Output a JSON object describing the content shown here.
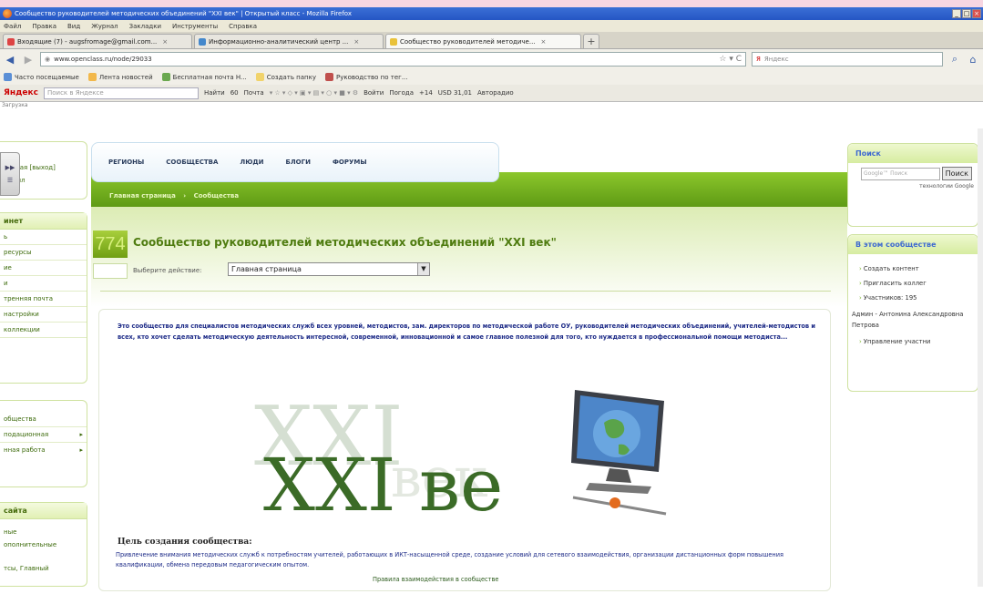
{
  "browser": {
    "window_title": "Сообщество руководителей методических объединений \"XXI век\" | Открытый класс - Mozilla Firefox",
    "menu": [
      "Файл",
      "Правка",
      "Вид",
      "Журнал",
      "Закладки",
      "Инструменты",
      "Справка"
    ],
    "tabs": [
      {
        "label": "Входящие (7) - augsfromage@gmail.com..."
      },
      {
        "label": "Информационно-аналитический центр ..."
      },
      {
        "label": "Сообщество руководителей методиче..."
      }
    ],
    "url": "www.openclass.ru/node/29033",
    "search_placeholder": "Яндекс",
    "bookmarks": [
      "Часто посещаемые",
      "Лента новостей",
      "Бесплатная почта H...",
      "Создать папку",
      "Руководство по тег..."
    ],
    "yandex_label": "Яндекс",
    "yandex_search_placeholder": "Поиск в Яндексе",
    "yandex_items": [
      "Найти",
      "60",
      "Почта",
      "Войти",
      "Погода",
      "+14",
      "USD 31,01",
      "Авторадио"
    ],
    "status_text": "Загрузка"
  },
  "left": {
    "box1_items": [
      "ход",
      "личная [выход]",
      "офайл"
    ],
    "box2_header": "инет",
    "box2_items": [
      "ь",
      "ресурсы",
      "ие",
      "и",
      "тренняя почта",
      "настройки",
      "коллекции"
    ],
    "box3_items": [
      "общества",
      "подационная",
      "нная работа"
    ],
    "box4_header": "сайта",
    "box4_items": [
      "ные",
      "ополнительные",
      "тсы, Главный"
    ]
  },
  "nav": {
    "items": [
      "РЕГИОНЫ",
      "СООБЩЕСТВА",
      "ЛЮДИ",
      "БЛОГИ",
      "ФОРУМЫ"
    ],
    "breadcrumbs": [
      "Главная страница",
      "Сообщества"
    ]
  },
  "main": {
    "badge": "774",
    "title": "Сообщество руководителей методических объединений \"XXI век\"",
    "action_label": "Выберите действие:",
    "action_value": "Главная страница",
    "intro": "Это сообщество для специалистов методических служб всех уровней, методистов, зам. директоров по методической работе ОУ, руководителей методических объединений, учителей-методистов и всех, кто хочет сделать методическую деятельность интересной, современной, инновационной и самое главное полезной для того, кто нуждается в профессиональной помощи методиста...",
    "logo_text": "XXI век",
    "goal_heading": "Цель создания сообщества:",
    "goal_text": "Привлечение внимания методических служб к потребностям учителей, работающих в ИКТ-насыщенной среде, создание условий для сетевого взаимодействия, организации дистанционных форм повышения квалификации, обмена передовым педагогическим опытом.",
    "rules_link": "Правила взаимодействия в сообществе"
  },
  "right": {
    "search_header": "Поиск",
    "search_placeholder": "Google™ Поиск",
    "search_button": "Поиск",
    "powered": "технологии Google",
    "community_header": "В этом сообществе",
    "items": [
      "Создать контент",
      "Пригласить коллег",
      "Участников: 195"
    ],
    "admin_text": "Админ - Антонина Александровна Петрова",
    "manage": "Управление участни"
  },
  "colors": {
    "accent_green": "#6fa81a",
    "title_green": "#4f7c10",
    "link_blue": "#1e2c88"
  }
}
